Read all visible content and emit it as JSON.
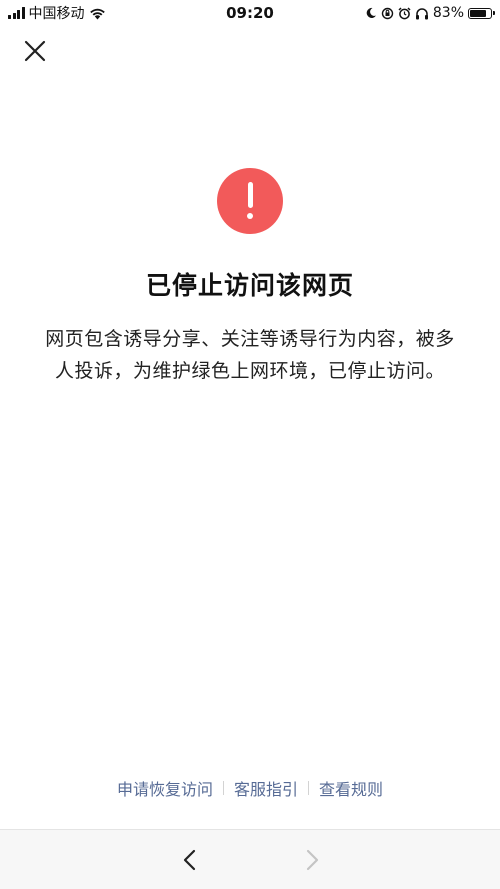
{
  "status_bar": {
    "carrier": "中国移动",
    "time": "09:20",
    "battery_percent": "83%",
    "battery_level": 0.83,
    "icons": [
      "signal-icon",
      "wifi-icon",
      "moon-icon",
      "orientation-lock-icon",
      "alarm-icon",
      "headphones-icon",
      "battery-icon"
    ]
  },
  "header": {
    "close_icon": "close-icon"
  },
  "main": {
    "icon": "exclamation-icon",
    "icon_color": "#f25a5a",
    "title": "已停止访问该网页",
    "description": "网页包含诱导分享、关注等诱导行为内容，被多人投诉，为维护绿色上网环境，已停止访问。"
  },
  "footer": {
    "links": [
      "申请恢复访问",
      "客服指引",
      "查看规则"
    ],
    "link_color": "#576b95"
  },
  "nav_bar": {
    "back_icon": "chevron-left-icon",
    "forward_icon": "chevron-right-icon"
  }
}
